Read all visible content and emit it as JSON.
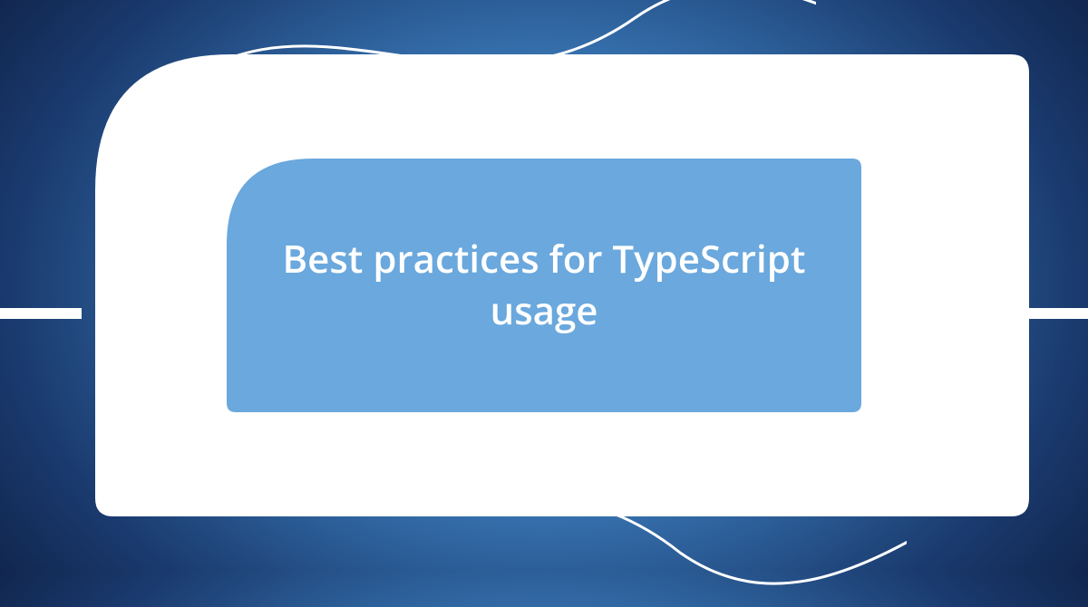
{
  "card": {
    "title": "Best practices for TypeScript usage"
  },
  "colors": {
    "inner": "#6aa8dd",
    "outer": "#ffffff"
  }
}
